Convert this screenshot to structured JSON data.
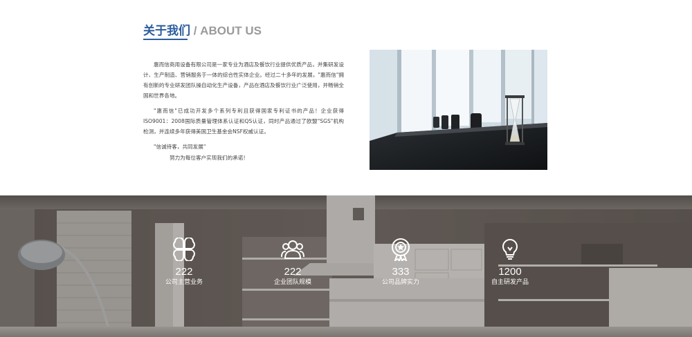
{
  "about": {
    "title_cn": "关于我们",
    "title_en": " / ABOUT US",
    "paragraphs": [
      "惠而信商用设备有限公司是一家专业为酒店及餐饮行业提供优质产品，并集研发设计、生产制造、营销服务于一体的综合性实体企业。经过二十多年的发展，\"惠而信\"拥有创新的专业研发团队操自动化生产设备，产品在酒店及餐饮行业广泛使用，并畅销全国和世界各地。",
      "\"惠而信\"已成功开发多个系列专利且获得国家专利证书的产品！企业获得ISO9001：2008国际质量管理体系认证和QS认证，同时产品通过了欧盟\"SGS\"机构检测，并连续多年获得美国卫生基金会NSF权威认证。"
    ],
    "slogan_1": "\"信诚待客，共同发展\"",
    "slogan_2": "努力为每位客户实现我们的承诺！"
  },
  "stats": [
    {
      "icon": "grid-icon",
      "value": "222",
      "label": "公司主营业务"
    },
    {
      "icon": "team-icon",
      "value": "222",
      "label": "企业团队规模"
    },
    {
      "icon": "award-icon",
      "value": "333",
      "label": "公司品牌实力"
    },
    {
      "icon": "lightbulb-icon",
      "value": "1200",
      "label": "自主研发产品"
    }
  ],
  "colors": {
    "accent_blue": "#2a5d9c",
    "title_grey": "#9a9a9a"
  }
}
